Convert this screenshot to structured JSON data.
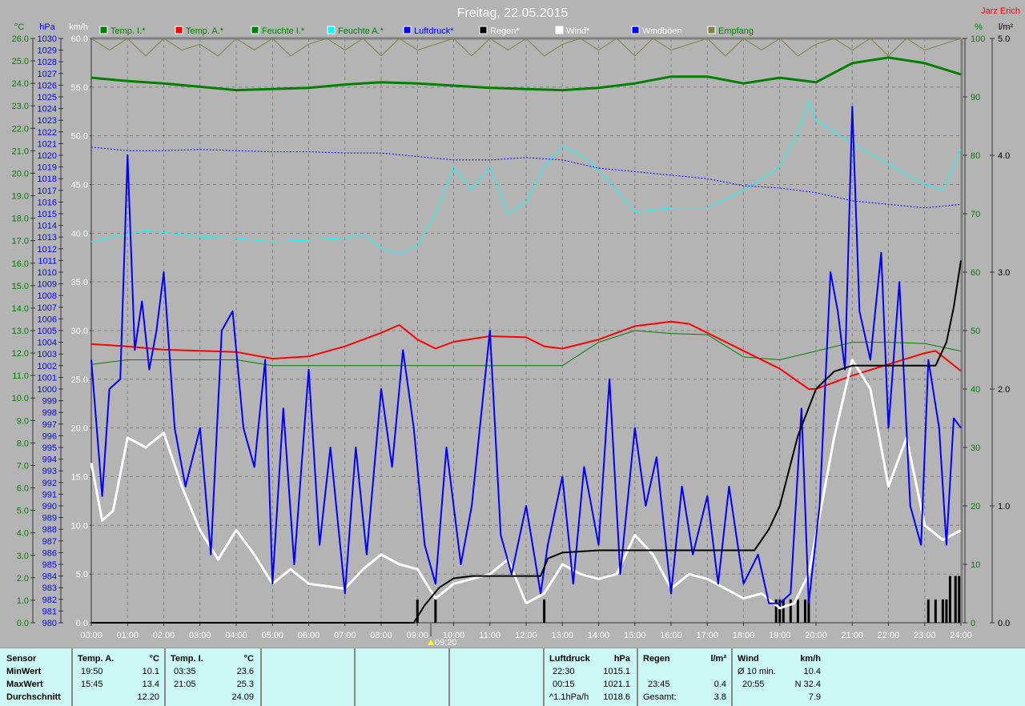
{
  "title": "Freitag, 22.05.2015",
  "author": "Jarz Erich",
  "marker_label": "09:20",
  "chart_data": {
    "type": "line",
    "title": "Freitag, 22.05.2015",
    "xlabel": "",
    "x_range": [
      0,
      24
    ],
    "x_ticks": [
      "00:00",
      "01:00",
      "02:00",
      "03:00",
      "04:00",
      "05:00",
      "06:00",
      "07:00",
      "08:00",
      "09:00",
      "10:00",
      "11:00",
      "12:00",
      "13:00",
      "14:00",
      "15:00",
      "16:00",
      "17:00",
      "18:00",
      "19:00",
      "20:00",
      "21:00",
      "22:00",
      "23:00",
      "24:00"
    ],
    "axes": {
      "temp": {
        "unit": "°C",
        "range": [
          0,
          26
        ],
        "step": 1,
        "color": "#008000"
      },
      "pressure": {
        "unit": "hPa",
        "range": [
          980,
          1030
        ],
        "step": 1,
        "color": "#0000ff"
      },
      "wind": {
        "unit": "km/h",
        "range": [
          0,
          60
        ],
        "step": 5,
        "color": "#ffffff"
      },
      "humidity": {
        "unit": "%",
        "range": [
          0,
          100
        ],
        "step": 10,
        "color": "#008000"
      },
      "rain": {
        "unit": "l/m²",
        "range": [
          0,
          5
        ],
        "step": 1,
        "color": "#000000"
      }
    },
    "grid": true,
    "legend": [
      {
        "name": "Temp. I.*",
        "color": "#008000"
      },
      {
        "name": "Temp. A.*",
        "color": "#ff0000"
      },
      {
        "name": "Feuchte I.*",
        "color": "#008000"
      },
      {
        "name": "Feuchte A.*",
        "color": "#00ffff"
      },
      {
        "name": "Luftdruck*",
        "color": "#0000ff"
      },
      {
        "name": "Regen*",
        "color": "#000000"
      },
      {
        "name": "Wind*",
        "color": "#ffffff"
      },
      {
        "name": "Windböen",
        "color": "#0000ff"
      },
      {
        "name": "Empfang",
        "color": "#808040"
      }
    ],
    "series": [
      {
        "name": "Empfang",
        "axis": "humidity",
        "color": "#808040",
        "width": 1,
        "x": [
          0,
          0.5,
          1,
          1.5,
          2,
          2.5,
          3,
          3.5,
          4,
          4.5,
          5,
          5.5,
          6,
          6.5,
          7,
          7.5,
          8,
          8.5,
          9,
          9.5,
          10,
          10.5,
          11,
          11.5,
          12,
          12.5,
          13,
          13.5,
          14,
          14.5,
          15,
          15.5,
          16,
          16.5,
          17,
          17.5,
          18,
          18.5,
          19,
          19.5,
          20,
          20.5,
          21,
          21.5,
          22,
          22.5,
          23,
          23.5,
          24
        ],
        "values": [
          100,
          98,
          100,
          97,
          100,
          98,
          99,
          97,
          100,
          98,
          100,
          97,
          99,
          100,
          98,
          100,
          97,
          100,
          98,
          99,
          100,
          97,
          100,
          98,
          100,
          97,
          99,
          100,
          98,
          100,
          97,
          100,
          98,
          99,
          100,
          97,
          100,
          98,
          100,
          97,
          99,
          100,
          98,
          100,
          97,
          100,
          98,
          99,
          100
        ]
      },
      {
        "name": "Feuchte I.",
        "axis": "humidity",
        "color": "#008000",
        "width": 1,
        "x": [
          0,
          1,
          2,
          3,
          4,
          5,
          6,
          7,
          8,
          9,
          10,
          11,
          12,
          13,
          14,
          15,
          16,
          17,
          18,
          19,
          20,
          21,
          22,
          23,
          24
        ],
        "values": [
          44.2,
          45,
          45,
          45,
          45,
          44,
          44,
          44,
          44,
          44,
          44,
          44,
          44,
          44,
          48,
          50,
          49.5,
          49.3,
          45.5,
          45,
          46.5,
          48,
          48,
          47.8,
          46.5
        ]
      },
      {
        "name": "Feuchte A.",
        "axis": "humidity",
        "color": "#00ffff",
        "width": 1,
        "x": [
          0,
          1,
          1.5,
          2,
          3,
          4,
          5,
          6,
          7,
          7.5,
          8,
          8.5,
          9,
          9.5,
          10,
          10.5,
          11,
          11.5,
          12,
          12.5,
          13,
          13.5,
          14,
          14.5,
          15,
          16,
          17,
          18,
          19,
          19.5,
          19.8,
          20,
          21,
          22,
          23,
          23.5,
          24
        ],
        "values": [
          65.2,
          66.5,
          67.1,
          66.8,
          66,
          65.8,
          65.2,
          65.5,
          65.8,
          66.5,
          64,
          63,
          64.5,
          70,
          78,
          74,
          78,
          69.9,
          72,
          78,
          81.5,
          80,
          77.5,
          74,
          70.3,
          71,
          71,
          74,
          78,
          84,
          89.2,
          86,
          82,
          78.5,
          75,
          74,
          81
        ]
      },
      {
        "name": "Luftdruck",
        "axis": "pressure",
        "color": "#0000ff",
        "width": 1,
        "dash": "2,2",
        "x": [
          0,
          1,
          2,
          3,
          4,
          5,
          6,
          7,
          8,
          9,
          10,
          11,
          12,
          13,
          14,
          15,
          16,
          17,
          18,
          19,
          20,
          21,
          22,
          23,
          24
        ],
        "values": [
          1020.7,
          1020.4,
          1020.4,
          1020.5,
          1020.4,
          1020.3,
          1020.3,
          1020.2,
          1020.2,
          1019.9,
          1019.6,
          1019.6,
          1019.8,
          1019.6,
          1018.9,
          1018.6,
          1018.3,
          1018,
          1017.4,
          1017.2,
          1016.8,
          1016.1,
          1015.8,
          1015.5,
          1015.8
        ]
      },
      {
        "name": "Temp. I.",
        "axis": "temp",
        "color": "#008000",
        "width": 3,
        "x": [
          0,
          1,
          2,
          3,
          4,
          5,
          6,
          7,
          8,
          9,
          10,
          11,
          12,
          13,
          14,
          15,
          16,
          17,
          18,
          19,
          20,
          21,
          22,
          23,
          24
        ],
        "values": [
          24.25,
          24.1,
          24.0,
          23.85,
          23.7,
          23.75,
          23.8,
          23.95,
          24.05,
          24.0,
          23.9,
          23.8,
          23.75,
          23.7,
          23.8,
          24.0,
          24.3,
          24.3,
          24.0,
          24.25,
          24.05,
          24.9,
          25.15,
          24.9,
          24.4
        ]
      },
      {
        "name": "Temp. A.",
        "axis": "temp",
        "color": "#ff0000",
        "width": 2,
        "x": [
          0,
          1,
          2,
          3,
          4,
          5,
          6,
          7,
          8,
          8.5,
          9,
          9.5,
          10,
          11,
          12,
          12.5,
          13,
          14,
          15,
          15.5,
          16,
          16.5,
          17,
          18,
          19,
          19.8,
          20,
          21,
          22,
          23,
          23.3,
          24
        ],
        "values": [
          12.4,
          12.3,
          12.15,
          12.1,
          12.05,
          11.75,
          11.85,
          12.3,
          12.9,
          13.25,
          12.6,
          12.2,
          12.5,
          12.75,
          12.7,
          12.3,
          12.2,
          12.6,
          13.2,
          13.3,
          13.4,
          13.3,
          12.9,
          12.1,
          11.3,
          10.4,
          10.4,
          11.0,
          11.5,
          12.0,
          12.1,
          11.2
        ]
      },
      {
        "name": "Wind",
        "axis": "wind",
        "color": "#ffffff",
        "width": 3,
        "x": [
          0,
          0.3,
          0.6,
          1,
          1.5,
          2,
          2.5,
          3,
          3.5,
          4,
          4.5,
          5,
          5.5,
          6,
          7,
          7.5,
          8,
          8.5,
          9,
          9.5,
          10,
          10.5,
          11,
          11.5,
          12,
          12.5,
          13,
          13.5,
          14,
          14.5,
          15,
          15.5,
          16,
          16.5,
          17,
          17.5,
          18,
          18.5,
          19,
          19.4,
          19.8,
          20.2,
          20.5,
          21,
          21.5,
          22,
          22.5,
          23,
          23.5,
          24
        ],
        "values": [
          16.4,
          10.5,
          11.5,
          19,
          18,
          19.5,
          14,
          9.5,
          6.5,
          9.5,
          7,
          4,
          5.5,
          4,
          3.5,
          5.5,
          7,
          6,
          5.5,
          2.5,
          4,
          4.5,
          5,
          6.5,
          2,
          3,
          6,
          5,
          4.5,
          5,
          9,
          7,
          3.5,
          5,
          4.5,
          3.5,
          2.5,
          3,
          1.5,
          2,
          5,
          13,
          19,
          27,
          24,
          14,
          19,
          10,
          8.5,
          9.5
        ]
      },
      {
        "name": "Windböen",
        "axis": "wind",
        "color": "#0000ff",
        "width": 2,
        "x": [
          0,
          0.3,
          0.5,
          0.8,
          1,
          1.2,
          1.4,
          1.6,
          1.8,
          2,
          2.3,
          2.6,
          3,
          3.3,
          3.6,
          3.9,
          4.2,
          4.5,
          4.8,
          5,
          5.3,
          5.6,
          6,
          6.3,
          6.6,
          7,
          7.3,
          7.6,
          8,
          8.3,
          8.6,
          8.9,
          9.2,
          9.5,
          9.8,
          10.2,
          10.5,
          11,
          11.3,
          11.6,
          12,
          12.4,
          12.6,
          13,
          13.3,
          13.6,
          14,
          14.3,
          14.6,
          15,
          15.3,
          15.6,
          16,
          16.3,
          16.6,
          17,
          17.3,
          17.6,
          18,
          18.4,
          18.7,
          19,
          19.3,
          19.6,
          19.8,
          20.1,
          20.4,
          20.6,
          20.8,
          21,
          21.2,
          21.5,
          21.8,
          22,
          22.3,
          22.6,
          22.9,
          23.1,
          23.4,
          23.6,
          23.8,
          24
        ],
        "values": [
          27,
          13,
          24,
          25,
          48,
          28,
          33,
          26,
          30,
          36,
          20,
          14,
          20,
          7,
          30,
          32,
          20,
          16,
          27,
          4,
          22,
          6,
          26,
          8,
          18,
          3,
          18,
          7,
          24,
          16,
          28,
          20,
          8,
          4,
          18,
          6,
          12,
          30,
          9,
          5,
          12,
          3,
          8,
          15,
          4,
          16,
          8,
          25,
          5,
          20,
          12,
          17,
          3,
          14,
          7,
          13,
          4,
          14,
          4,
          7,
          2,
          2,
          3,
          22,
          2,
          12,
          36,
          32,
          26,
          53,
          32,
          27,
          38,
          20,
          35,
          12,
          8,
          27,
          20,
          8,
          21,
          20
        ]
      },
      {
        "name": "Regen",
        "axis": "rain",
        "color": "#000000",
        "width": 2,
        "x": [
          0,
          8.9,
          9.2,
          9.6,
          10,
          10.5,
          12.4,
          12.6,
          13,
          14,
          18.3,
          18.7,
          19,
          19.5,
          20,
          20.5,
          21,
          23.3,
          23.6,
          23.8,
          24
        ],
        "values": [
          0,
          0,
          0.15,
          0.3,
          0.38,
          0.4,
          0.4,
          0.55,
          0.6,
          0.62,
          0.62,
          0.8,
          1.0,
          1.6,
          2.0,
          2.15,
          2.2,
          2.2,
          2.4,
          2.7,
          3.1
        ]
      }
    ],
    "rain_bars": {
      "axis": "rain",
      "x": [
        9.0,
        9.5,
        12.5,
        18.9,
        19.0,
        19.1,
        19.3,
        19.5,
        19.7,
        19.8,
        23.1,
        23.3,
        23.5,
        23.6,
        23.7,
        23.85,
        23.95
      ],
      "values": [
        0.2,
        0.2,
        0.2,
        0.2,
        0.2,
        0.2,
        0.2,
        0.2,
        0.2,
        0.2,
        0.2,
        0.2,
        0.2,
        0.2,
        0.4,
        0.4,
        0.4
      ]
    }
  },
  "stats": {
    "sensor": {
      "header": "Sensor",
      "rows": [
        "MinWert",
        "MaxWert",
        "Durchschnitt"
      ]
    },
    "temp_a": {
      "header": "Temp. A.",
      "unit": "°C",
      "min_time": "19:50",
      "min": "10.1",
      "max_time": "15:45",
      "max": "13.4",
      "avg": "12.20"
    },
    "temp_i": {
      "header": "Temp. I.",
      "unit": "°C",
      "min_time": "03:35",
      "min": "23.6",
      "max_time": "21:05",
      "max": "25.3",
      "avg": "24.09"
    },
    "pressure": {
      "header": "Luftdruck",
      "unit": "hPa",
      "min_time": "22:30",
      "min": "1015.1",
      "max_time": "00:15",
      "max": "1021.1",
      "trend": "^1.1hPa/h",
      "avg": "1018.6"
    },
    "rain": {
      "header": "Regen",
      "unit": "l/m²",
      "max_time": "23:45",
      "max": "0.4",
      "total_label": "Gesamt:",
      "total": "3.8"
    },
    "wind": {
      "header": "Wind",
      "unit": "km/h",
      "avg10_label": "Ø 10 min.",
      "avg10": "10.4",
      "max_time": "20:55",
      "max": "N 32.4",
      "avg": "7.9"
    }
  }
}
